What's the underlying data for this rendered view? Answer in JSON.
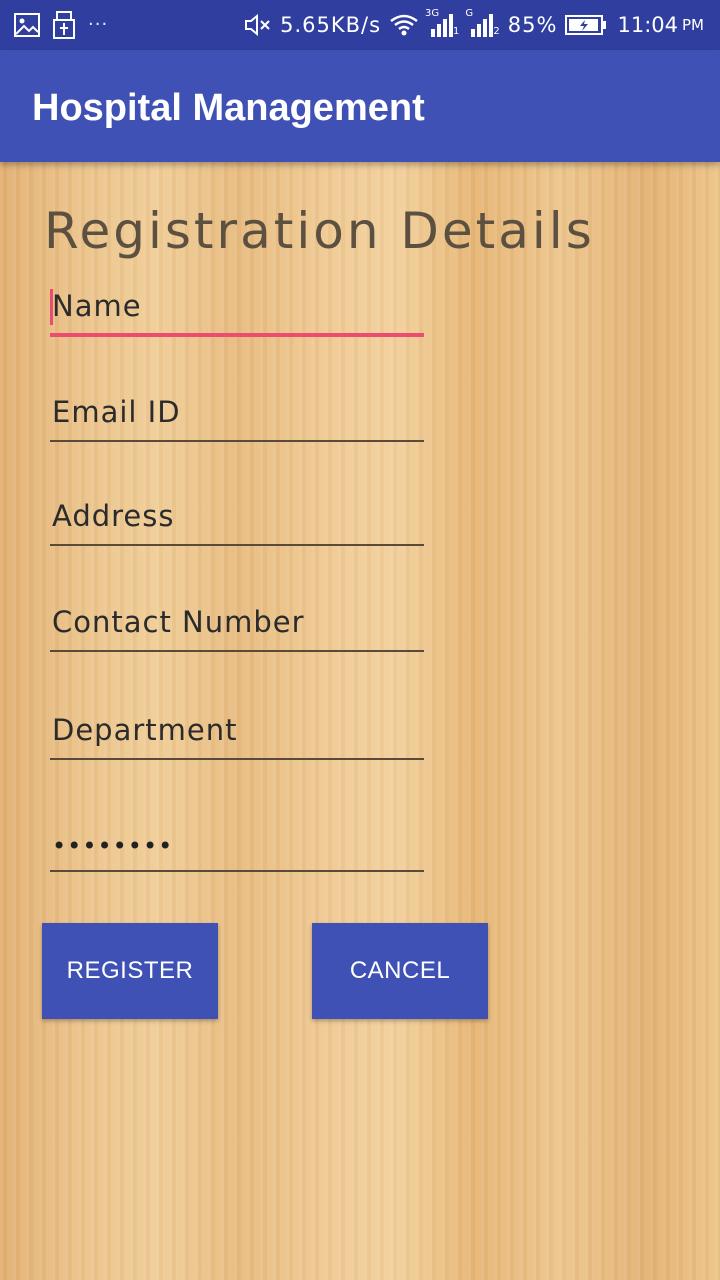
{
  "status_bar": {
    "left_icons": [
      "image-icon",
      "usb-icon"
    ],
    "more": "···",
    "network_speed": "5.65KB/s",
    "sim1_type": "3G",
    "sim1_slot": "1",
    "sim2_type": "G",
    "sim2_slot": "2",
    "battery": "85%",
    "time": "11:04",
    "ampm": "PM"
  },
  "app_bar": {
    "title": "Hospital Management",
    "color": "#3f51b5"
  },
  "form": {
    "heading": "Registration Details",
    "fields": [
      {
        "name": "name",
        "placeholder": "Name",
        "value": "",
        "focused": true
      },
      {
        "name": "email",
        "placeholder": "Email ID",
        "value": ""
      },
      {
        "name": "address",
        "placeholder": "Address",
        "value": ""
      },
      {
        "name": "contact",
        "placeholder": "Contact Number",
        "value": ""
      },
      {
        "name": "department",
        "placeholder": "Department",
        "value": ""
      },
      {
        "name": "password",
        "placeholder": "",
        "value": "••••••••"
      }
    ],
    "register_label": "REGISTER",
    "cancel_label": "CANCEL"
  },
  "colors": {
    "status_bar": "#303f9f",
    "accent": "#ec4c6f",
    "button": "#3f51b5"
  }
}
